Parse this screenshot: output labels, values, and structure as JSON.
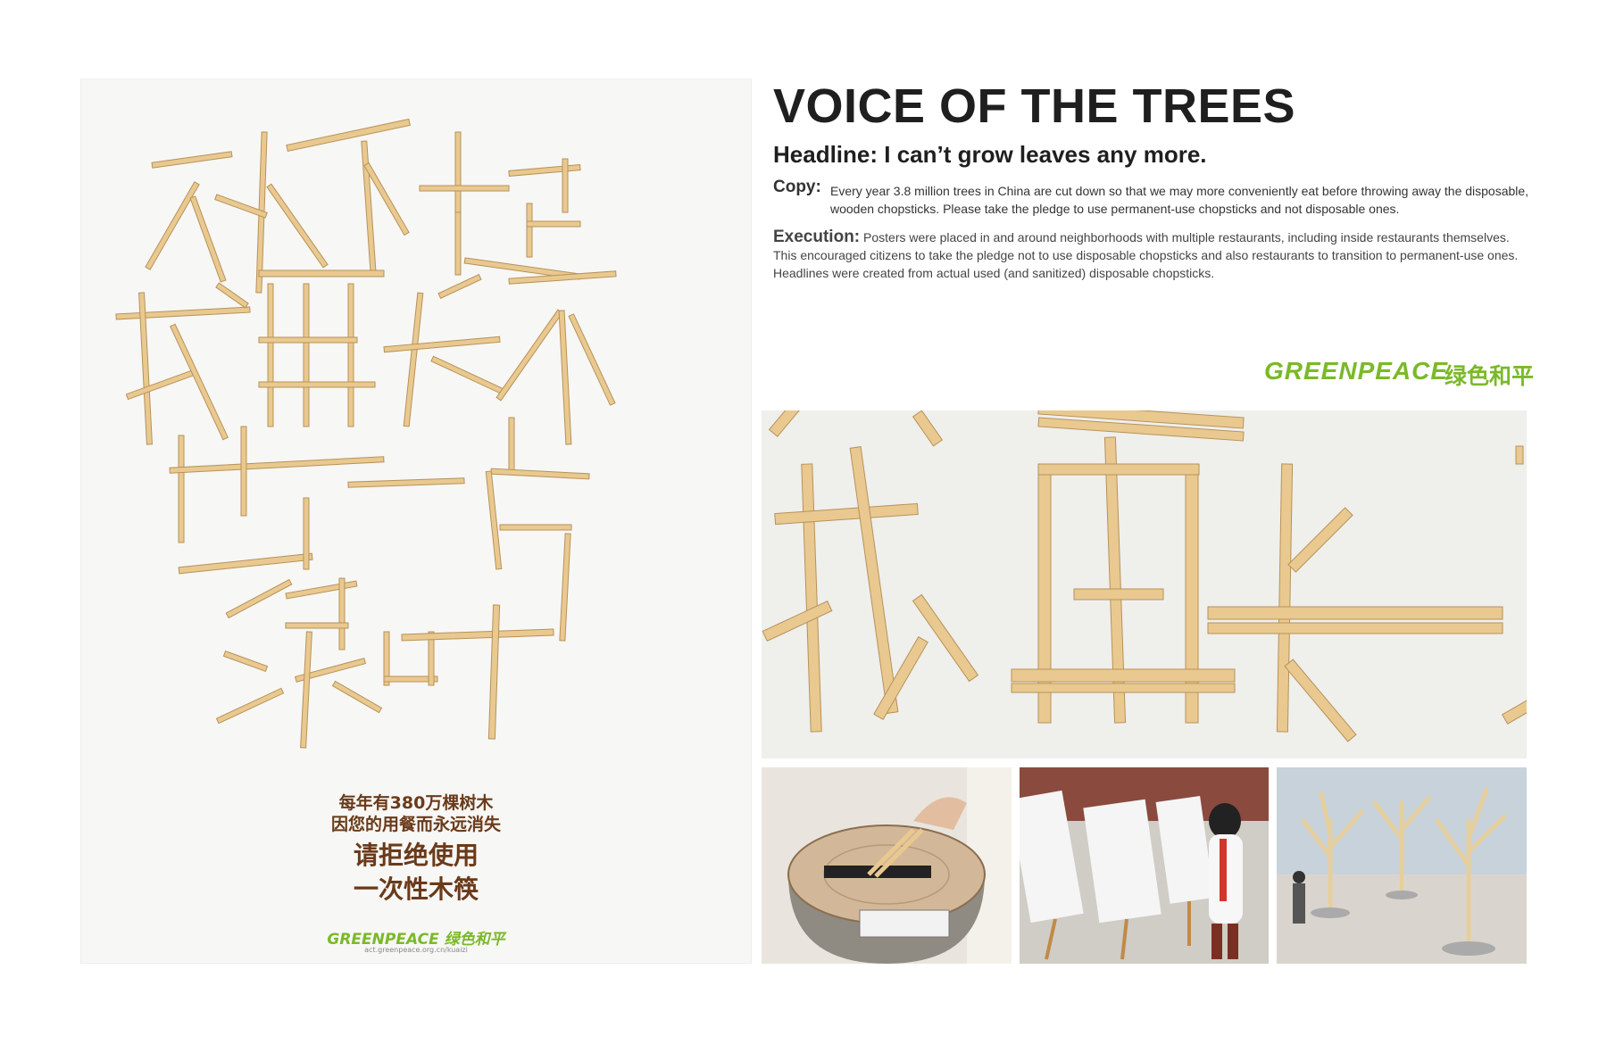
{
  "header": {
    "title": "VOICE OF THE TREES",
    "headline": "Headline: I can’t grow leaves any more."
  },
  "copy": {
    "label": "Copy:",
    "text": "Every year 3.8 million trees in China are cut down so that we may more conveniently eat before throwing away the disposable, wooden chopsticks. Please take the pledge to use permanent-use chopsticks and not disposable ones."
  },
  "execution": {
    "label": "Execution:",
    "text": "Posters were placed in and around neighborhoods with multiple restaurants, including inside restaurants themselves. This encouraged citizens to take the pledge not to use disposable chopsticks and also restaurants to transition to permanent-use ones. Headlines were created from actual used (and sanitized) disposable chopsticks."
  },
  "logo": {
    "en": "GREENPEACE",
    "cn": "绿色和平"
  },
  "poster": {
    "chopstick_headline": "对不起我再长不出一片绿叶",
    "line1": "每年有380万棵树木",
    "line2": "因您的用餐而永远消失",
    "line3": "请拒绝使用",
    "line4": "一次性木筷",
    "logo_en": "GREENPEACE",
    "logo_cn": "绿色和平",
    "url": "act.greenpeace.org.cn/kuaizi"
  },
  "colors": {
    "brand_green": "#7ab929",
    "poster_text_brown": "#6a3a1a",
    "chopstick": "#e9c98f"
  }
}
